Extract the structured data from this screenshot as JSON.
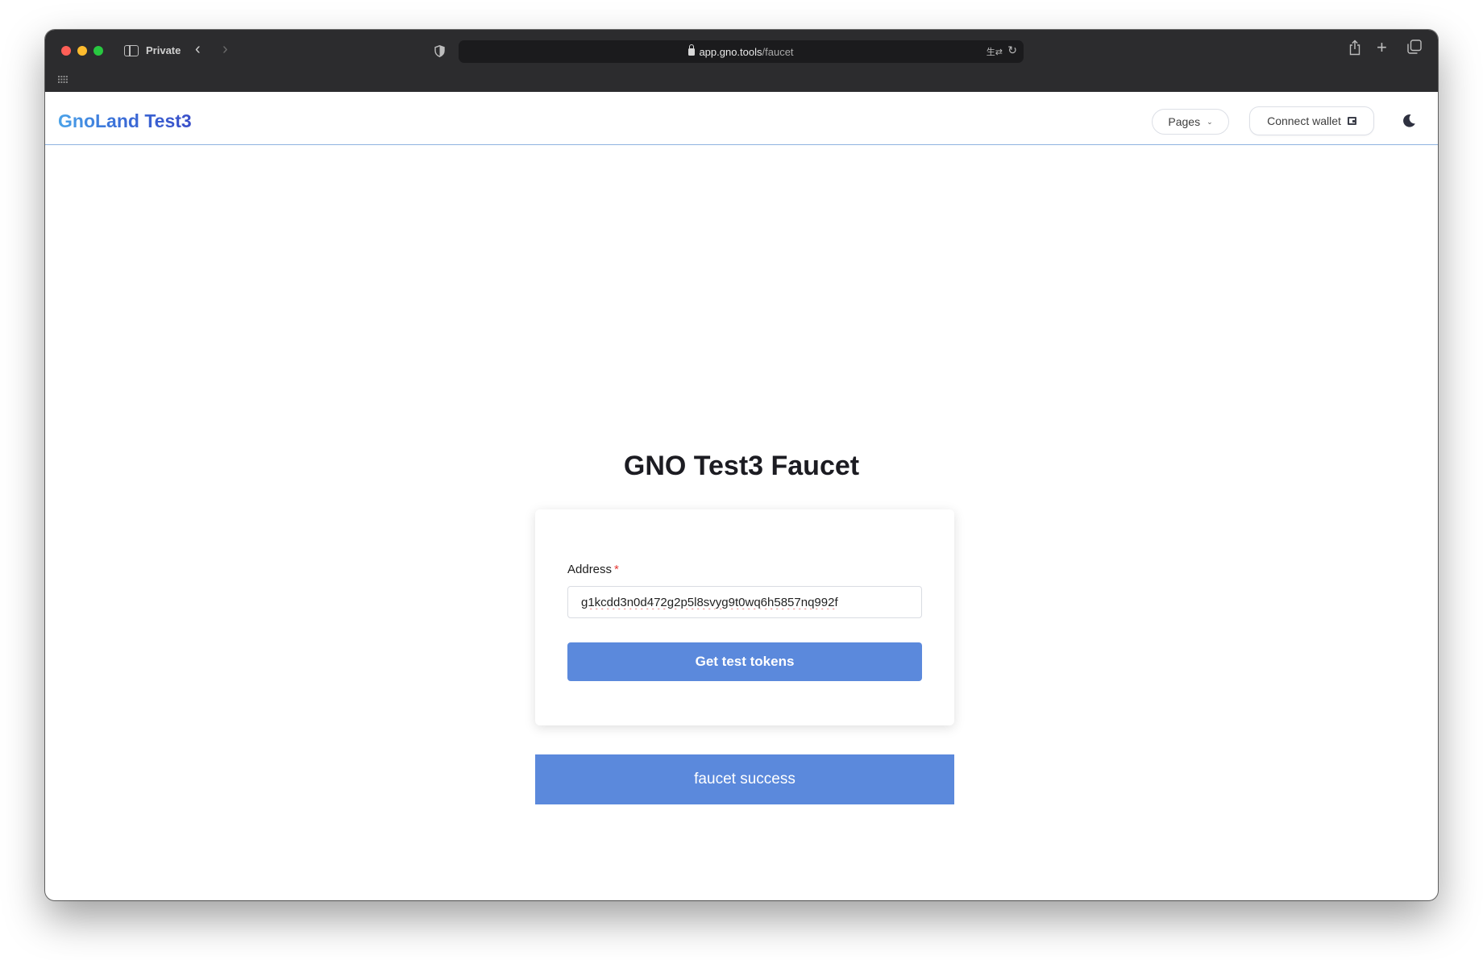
{
  "browser": {
    "mode_label": "Private",
    "url_host": "app.gno.tools",
    "url_path": "/faucet",
    "icons": [
      "sidebar-toggle-icon",
      "chevron-left-icon",
      "chevron-right-icon",
      "shield-icon",
      "lock-icon",
      "translate-icon",
      "reload-icon",
      "share-icon",
      "plus-icon",
      "tabs-icon",
      "grid-icon"
    ]
  },
  "header": {
    "brand": "GnoLand Test3",
    "pages_label": "Pages",
    "connect_label": "Connect wallet",
    "theme_icon": "moon-icon"
  },
  "main": {
    "title": "GNO Test3 Faucet",
    "form": {
      "address_label": "Address",
      "required_mark": "*",
      "address_value": "g1kcdd3n0d472g2p5l8svyg9t0wq6h5857nq992f",
      "submit_label": "Get test tokens"
    },
    "status_message": "faucet success"
  },
  "colors": {
    "accent": "#5b89dc",
    "brand_gradient_start": "#4aa3e9",
    "brand_gradient_end": "#3a4fc9",
    "required": "#e53935",
    "chrome_bg": "#2c2c2e"
  }
}
